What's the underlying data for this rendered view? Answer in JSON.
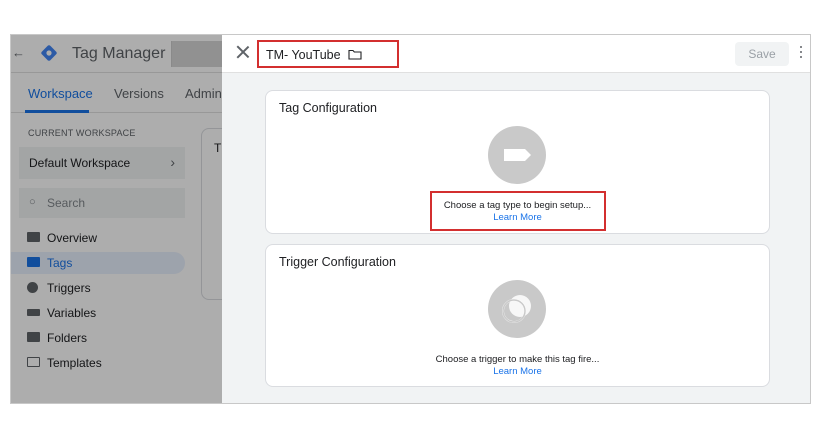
{
  "app": {
    "title": "Tag Manager",
    "back_glyph": "←",
    "tabs": [
      {
        "label": "Workspace",
        "active": true
      },
      {
        "label": "Versions",
        "active": false
      },
      {
        "label": "Admin",
        "active": false
      }
    ],
    "sidebar": {
      "current_workspace_label": "CURRENT WORKSPACE",
      "workspace_name": "Default Workspace",
      "search_placeholder": "Search",
      "items": [
        {
          "label": "Overview",
          "icon": "overview-icon"
        },
        {
          "label": "Tags",
          "icon": "tag-icon",
          "active": true
        },
        {
          "label": "Triggers",
          "icon": "trigger-icon"
        },
        {
          "label": "Variables",
          "icon": "variable-icon"
        },
        {
          "label": "Folders",
          "icon": "folder-icon"
        },
        {
          "label": "Templates",
          "icon": "template-icon"
        }
      ]
    },
    "ghost_card_text": "T"
  },
  "panel": {
    "tag_name": "TM- YouTube",
    "save_label": "Save",
    "tag_config": {
      "title": "Tag Configuration",
      "message": "Choose a tag type to begin setup...",
      "link": "Learn More"
    },
    "trigger_config": {
      "title": "Trigger Configuration",
      "message": "Choose a trigger to make this tag fire...",
      "link": "Learn More"
    }
  },
  "colors": {
    "accent": "#1a73e8",
    "highlight": "#d32f2f",
    "logo": "#4285f4"
  }
}
